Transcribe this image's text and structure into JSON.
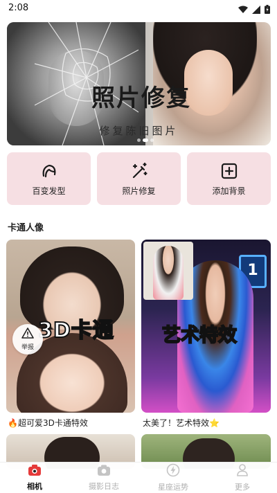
{
  "status_bar": {
    "time": "2:08"
  },
  "banner": {
    "title": "照片修复",
    "subtitle": "修复陈旧图片",
    "page_count": 3,
    "active_page": 2
  },
  "features": [
    {
      "label": "百变发型",
      "icon": "hairstyle-icon"
    },
    {
      "label": "照片修复",
      "icon": "magic-wand-icon"
    },
    {
      "label": "添加背景",
      "icon": "add-square-icon"
    }
  ],
  "section": {
    "title": "卡通人像"
  },
  "cards": [
    {
      "overlay_text": "3D卡通",
      "caption": "🔥超可爱3D卡通特效"
    },
    {
      "overlay_text": "艺术特效",
      "caption": "太美了！艺术特效⭐"
    }
  ],
  "report_badge": {
    "label": "举报"
  },
  "bottom_nav": [
    {
      "label": "相机",
      "icon": "camera-app-icon",
      "active": true
    },
    {
      "label": "摄影日志",
      "icon": "camera-icon",
      "active": false
    },
    {
      "label": "星座运势",
      "icon": "lightning-icon",
      "active": false
    },
    {
      "label": "更多",
      "icon": "person-icon",
      "active": false
    }
  ],
  "colors": {
    "feature_bg": "#f6dfe3",
    "nav_active_icon": "#e53a3a",
    "nav_inactive": "#b0b0b0"
  }
}
